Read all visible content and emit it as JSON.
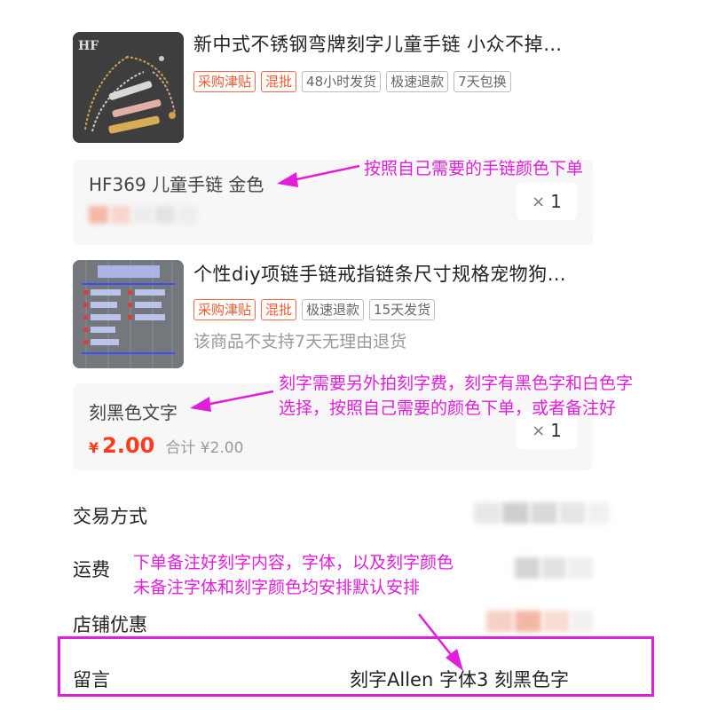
{
  "products": [
    {
      "title": "新中式不锈钢弯牌刻字儿童手链 小众不掉…",
      "thumb_mark": "HF",
      "tags": [
        {
          "label": "采购津贴",
          "style": "red"
        },
        {
          "label": "混批",
          "style": "red"
        },
        {
          "label": "48小时发货",
          "style": "gray"
        },
        {
          "label": "极速退款",
          "style": "gray"
        },
        {
          "label": "7天包换",
          "style": "gray"
        }
      ],
      "sku": "HF369 儿童手链 金色",
      "qty_symbol": "×",
      "qty": "1"
    },
    {
      "title": "个性diy项链手链戒指链条尺寸规格宠物狗…",
      "tags": [
        {
          "label": "采购津贴",
          "style": "red"
        },
        {
          "label": "混批",
          "style": "red"
        },
        {
          "label": "极速退款",
          "style": "gray"
        },
        {
          "label": "15天发货",
          "style": "gray"
        }
      ],
      "notice": "该商品不支持7天无理由退货",
      "sku": "刻黑色文字",
      "price_currency": "¥",
      "price_amount": "2.00",
      "subtotal": "合计 ¥2.00",
      "qty_symbol": "×",
      "qty": "1"
    }
  ],
  "order_rows": {
    "trade_label": "交易方式",
    "shipping_label": "运费",
    "shop_discount_label": "店铺优惠",
    "message_label": "留言",
    "message_value": "刻字Allen 字体3 刻黑色字"
  },
  "annotations": {
    "color": "#e01fdc",
    "note1": "按照自己需要的手链颜色下单",
    "note2_line1": "刻字需要另外拍刻字费，刻字有黑色字和白色字",
    "note2_line2": "选择，按照自己需要的颜色下单，或者备注好",
    "note3_line1": "下单备注好刻字内容，字体，以及刻字颜色",
    "note3_line2": "未备注字体和刻字颜色均安排默认安排"
  },
  "colors": {
    "price_red": "#ff3b1f",
    "tag_red": "#f2582f",
    "highlight_magenta": "#e01fdc"
  }
}
